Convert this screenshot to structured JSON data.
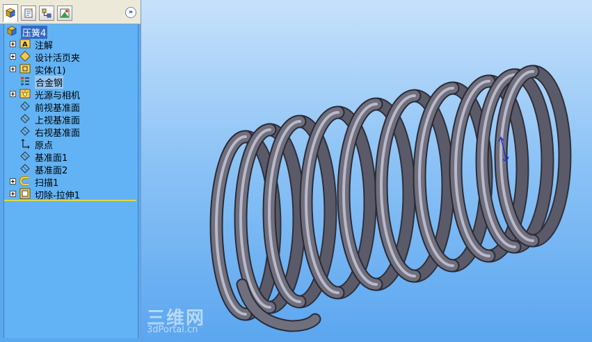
{
  "feature_tree": {
    "root": {
      "label": "压簧4",
      "icon": "part-icon"
    },
    "items": [
      {
        "label": "注解",
        "icon": "annotation-icon",
        "expandable": true
      },
      {
        "label": "设计活页夹",
        "icon": "design-binder-icon",
        "expandable": true
      },
      {
        "label": "实体(1)",
        "icon": "solid-body-icon",
        "expandable": true
      },
      {
        "label": "合金钢",
        "icon": "material-icon",
        "expandable": false
      },
      {
        "label": "光源与相机",
        "icon": "lights-cameras-icon",
        "expandable": true
      },
      {
        "label": "前视基准面",
        "icon": "plane-icon",
        "expandable": false
      },
      {
        "label": "上视基准面",
        "icon": "plane-icon",
        "expandable": false
      },
      {
        "label": "右视基准面",
        "icon": "plane-icon",
        "expandable": false
      },
      {
        "label": "原点",
        "icon": "origin-icon",
        "expandable": false
      },
      {
        "label": "基准面1",
        "icon": "plane-icon",
        "expandable": false
      },
      {
        "label": "基准面2",
        "icon": "plane-icon",
        "expandable": false
      },
      {
        "label": "扫描1",
        "icon": "sweep-icon",
        "expandable": true
      },
      {
        "label": "切除-拉伸1",
        "icon": "cut-extrude-icon",
        "expandable": true
      }
    ]
  },
  "panel_tabs": [
    {
      "name": "feature-manager-tab",
      "icon": "feature-tree-icon",
      "active": true
    },
    {
      "name": "property-manager-tab",
      "icon": "property-icon",
      "active": false
    },
    {
      "name": "configuration-manager-tab",
      "icon": "configuration-icon",
      "active": false
    },
    {
      "name": "display-manager-tab",
      "icon": "display-icon",
      "active": false
    }
  ],
  "expand_button": {
    "label": "»"
  },
  "watermark": {
    "logo_text": "三维网",
    "site_text": "3dPortal.cn"
  },
  "colors": {
    "tree_background": "#62b3f5",
    "selection": "#316ac5",
    "viewport_top": "#c7e1fb",
    "viewport_bottom": "#5ba6f0",
    "spring_metal": "#6f6f7d"
  }
}
